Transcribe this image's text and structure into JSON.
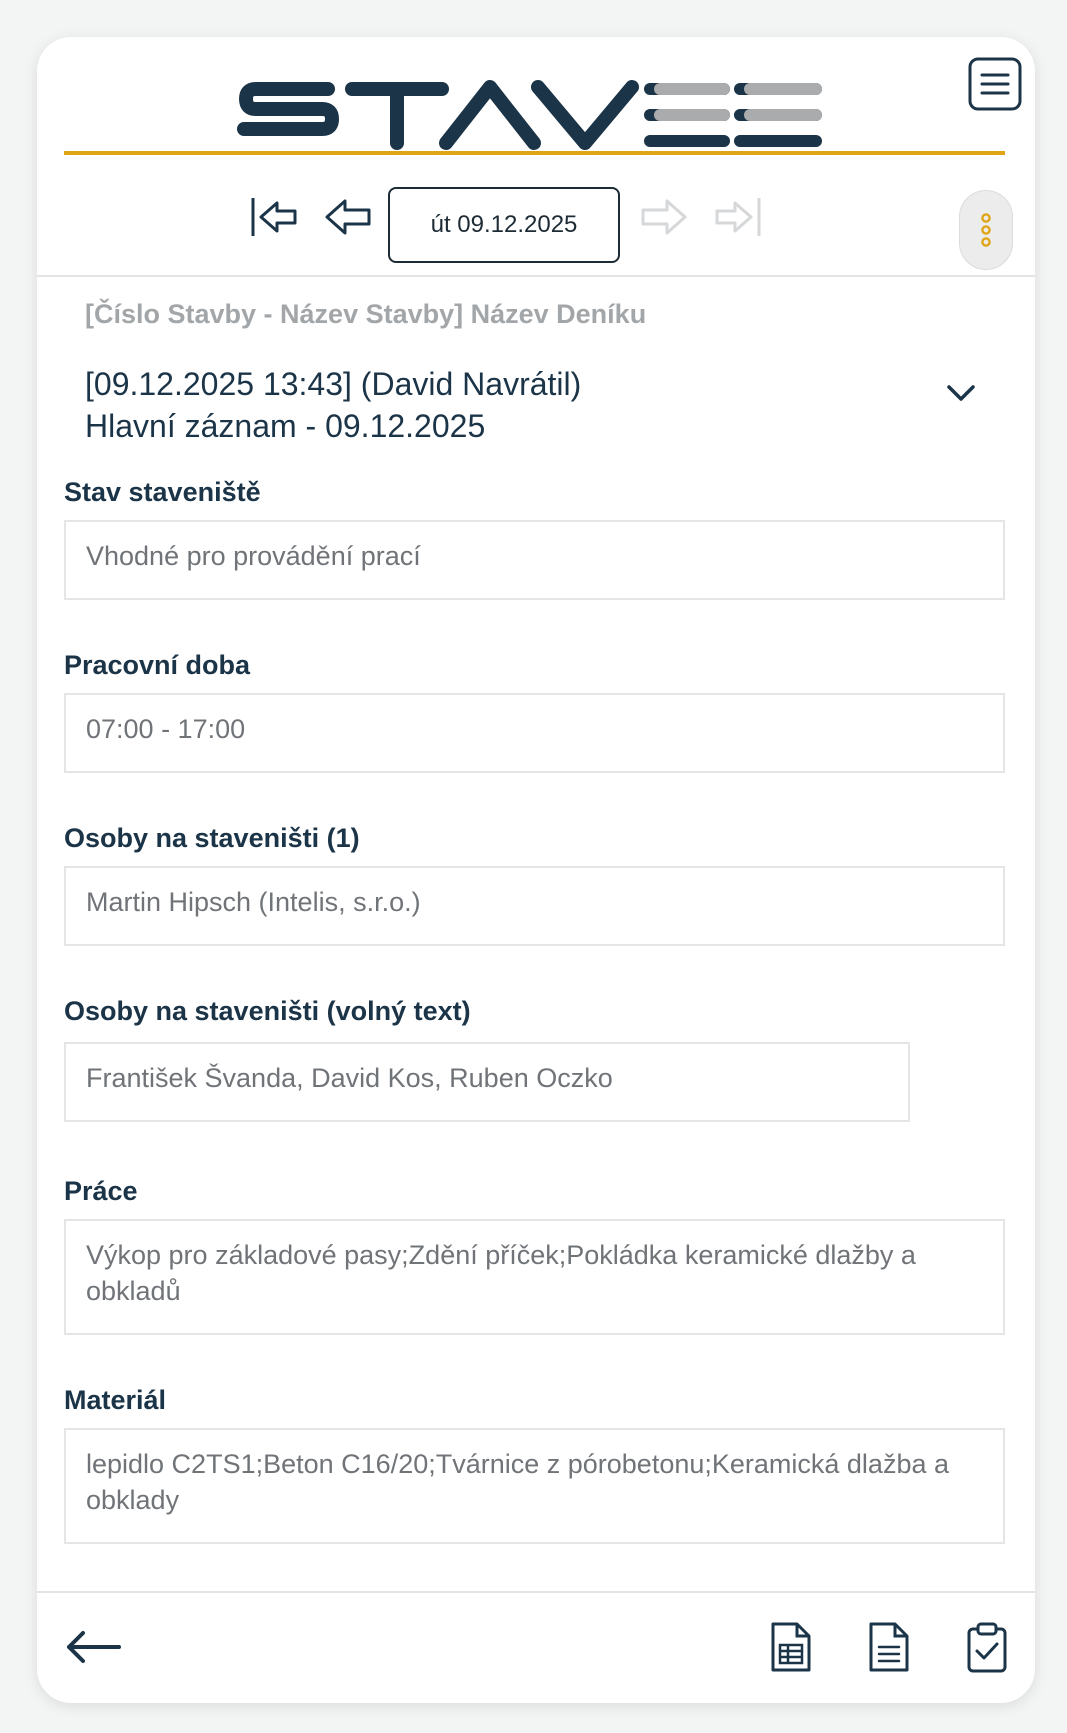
{
  "brand": {
    "logo_text": "STAVEE",
    "accent_color": "#e0a516",
    "dark_color": "#1b3447",
    "logo_gray": "#a9abac"
  },
  "header": {
    "menu_icon": "hamburger-menu-icon",
    "nav": {
      "first_icon": "first-page-arrow-icon",
      "prev_icon": "prev-arrow-icon",
      "date_label": "út 09.12.2025",
      "next_icon": "next-arrow-icon",
      "last_icon": "last-page-arrow-icon",
      "more_icon": "kebab-menu-icon"
    }
  },
  "diary": {
    "name": "[Číslo Stavby - Název Stavby] Název Deníku",
    "entry_line1": "[09.12.2025 13:43] (David Navrátil)",
    "entry_line2": "Hlavní záznam - 09.12.2025"
  },
  "fields": {
    "site_state": {
      "label": "Stav staveniště",
      "value": "Vhodné pro provádění prací"
    },
    "working_hours": {
      "label": "Pracovní doba",
      "value": "07:00 - 17:00"
    },
    "persons": {
      "label": "Osoby na staveništi (1)",
      "value": "Martin Hipsch (Intelis, s.r.o.)"
    },
    "persons_free": {
      "label": "Osoby na staveništi (volný text)",
      "value": "František Švanda, David Kos, Ruben Oczko"
    },
    "work": {
      "label": "Práce",
      "value": "Výkop pro základové pasy;Zdění příček;Pokládka keramické dlažby a obkladů"
    },
    "material": {
      "label": "Materiál",
      "value": "lepidlo C2TS1;Beton C16/20;Tvárnice z pórobetonu;Keramická dlažba a obklady"
    }
  },
  "footer": {
    "back_icon": "back-arrow-icon",
    "icons": [
      "spreadsheet-document-icon",
      "text-document-icon",
      "clipboard-check-icon"
    ]
  }
}
